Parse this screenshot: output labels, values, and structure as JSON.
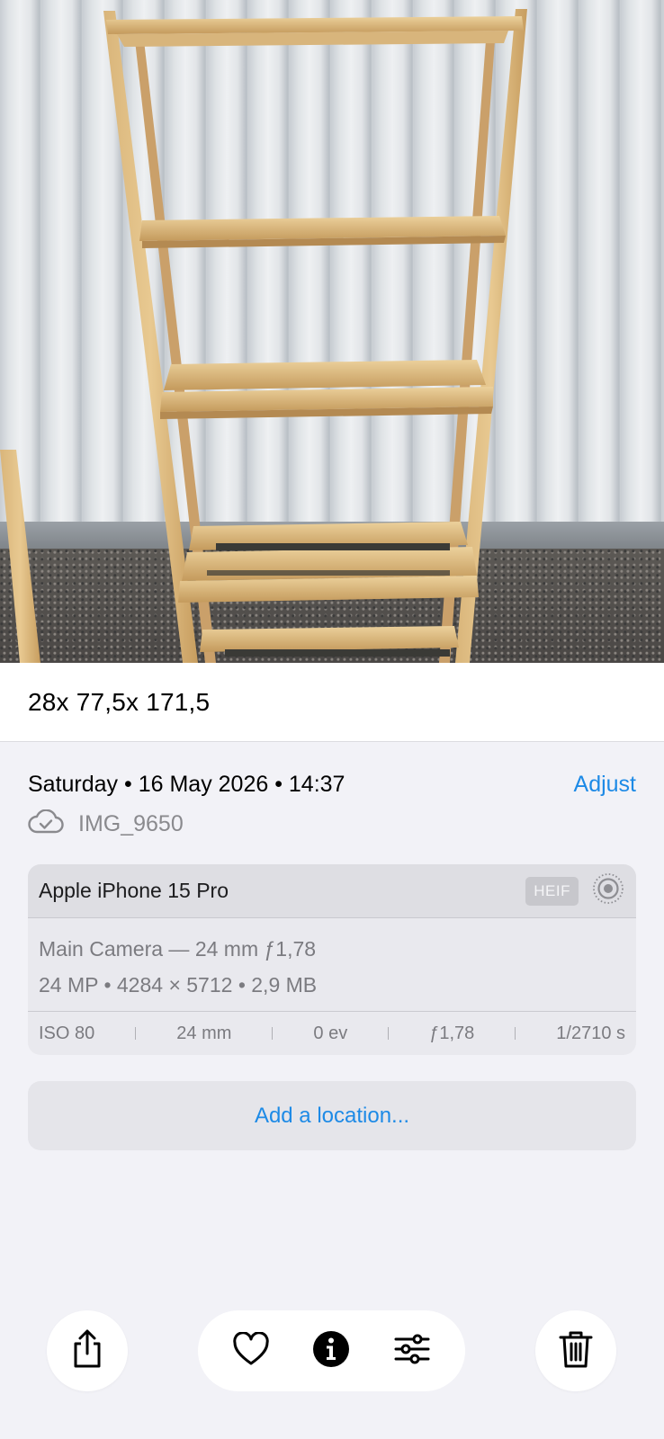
{
  "photo": {
    "description_icon": "wooden-shelf-photo"
  },
  "caption": {
    "text": "28x 77,5x 171,5"
  },
  "info": {
    "date_text": "Saturday • 16 May 2026 • 14:37",
    "adjust_label": "Adjust",
    "file_name": "IMG_9650",
    "cloud_icon": "cloud-check-icon"
  },
  "camera": {
    "device": "Apple iPhone 15 Pro",
    "format_badge": "HEIF",
    "lens": "Main Camera — 24 mm ƒ1,78",
    "specs": "24 MP  •  4284 × 5712  •  2,9 MB",
    "exif": {
      "iso": "ISO 80",
      "focal": "24 mm",
      "ev": "0 ev",
      "aperture": "ƒ1,78",
      "shutter": "1/2710 s"
    }
  },
  "location": {
    "label": "Add a location..."
  },
  "toolbar": {
    "icons": [
      "share-icon",
      "heart-icon",
      "info-icon",
      "adjust-sliders-icon",
      "trash-icon"
    ],
    "accent": "#1d8ae6"
  }
}
